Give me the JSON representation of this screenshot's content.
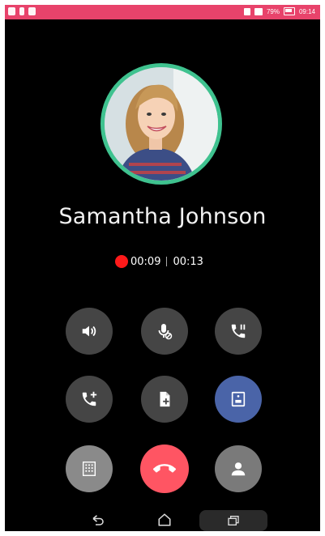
{
  "call": {
    "contact_name": "Samantha Johnson",
    "recording_time": "00:09",
    "call_duration": "00:13"
  },
  "status_bar": {
    "battery_percent": "79%",
    "time": "09:14"
  },
  "controls": [
    {
      "name": "speaker-button",
      "icon": "speaker-icon"
    },
    {
      "name": "mute-button",
      "icon": "mic-off-icon"
    },
    {
      "name": "hold-button",
      "icon": "call-hold-icon"
    },
    {
      "name": "add-call-button",
      "icon": "add-call-icon"
    },
    {
      "name": "notes-button",
      "icon": "note-add-icon"
    },
    {
      "name": "record-button",
      "icon": "record-icon"
    },
    {
      "name": "dialpad-button",
      "icon": "dialpad-icon"
    },
    {
      "name": "end-call-button",
      "icon": "end-call-icon"
    },
    {
      "name": "contact-button",
      "icon": "person-icon"
    }
  ],
  "colors": {
    "status_bar": "#e8436b",
    "avatar_ring": "#3fc28f",
    "end_call": "#ff5563",
    "record_active": "#4a64a8",
    "rec_dot": "#ff1a1a"
  }
}
